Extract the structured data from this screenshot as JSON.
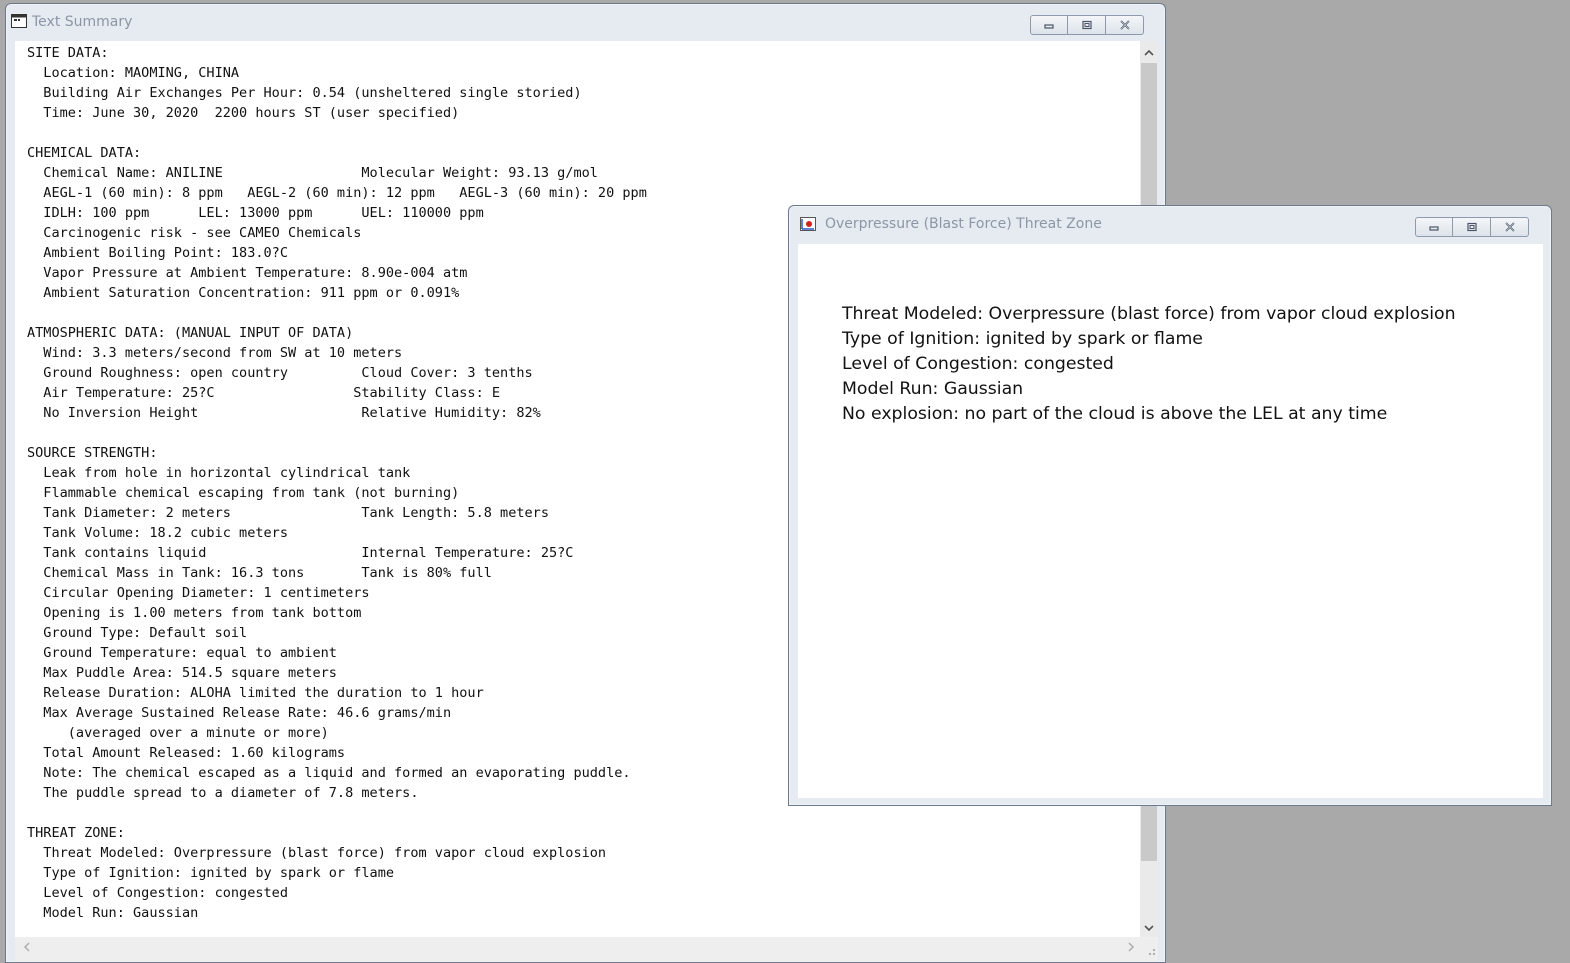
{
  "text_summary_window": {
    "title": "Text Summary",
    "lines": [
      "SITE DATA:",
      "  Location: MAOMING, CHINA",
      "  Building Air Exchanges Per Hour: 0.54 (unsheltered single storied)",
      "  Time: June 30, 2020  2200 hours ST (user specified)",
      "",
      "CHEMICAL DATA:",
      "  Chemical Name: ANILINE                 Molecular Weight: 93.13 g/mol",
      "  AEGL-1 (60 min): 8 ppm   AEGL-2 (60 min): 12 ppm   AEGL-3 (60 min): 20 ppm",
      "  IDLH: 100 ppm      LEL: 13000 ppm      UEL: 110000 ppm",
      "  Carcinogenic risk - see CAMEO Chemicals",
      "  Ambient Boiling Point: 183.0?C",
      "  Vapor Pressure at Ambient Temperature: 8.90e-004 atm",
      "  Ambient Saturation Concentration: 911 ppm or 0.091%",
      "",
      "ATMOSPHERIC DATA: (MANUAL INPUT OF DATA)",
      "  Wind: 3.3 meters/second from SW at 10 meters",
      "  Ground Roughness: open country         Cloud Cover: 3 tenths",
      "  Air Temperature: 25?C                 Stability Class: E",
      "  No Inversion Height                    Relative Humidity: 82%",
      "",
      "SOURCE STRENGTH:",
      "  Leak from hole in horizontal cylindrical tank",
      "  Flammable chemical escaping from tank (not burning)",
      "  Tank Diameter: 2 meters                Tank Length: 5.8 meters",
      "  Tank Volume: 18.2 cubic meters",
      "  Tank contains liquid                   Internal Temperature: 25?C",
      "  Chemical Mass in Tank: 16.3 tons       Tank is 80% full",
      "  Circular Opening Diameter: 1 centimeters",
      "  Opening is 1.00 meters from tank bottom",
      "  Ground Type: Default soil",
      "  Ground Temperature: equal to ambient",
      "  Max Puddle Area: 514.5 square meters",
      "  Release Duration: ALOHA limited the duration to 1 hour",
      "  Max Average Sustained Release Rate: 46.6 grams/min",
      "     (averaged over a minute or more)",
      "  Total Amount Released: 1.60 kilograms",
      "  Note: The chemical escaped as a liquid and formed an evaporating puddle.",
      "  The puddle spread to a diameter of 7.8 meters.",
      "",
      "THREAT ZONE:",
      "  Threat Modeled: Overpressure (blast force) from vapor cloud explosion",
      "  Type of Ignition: ignited by spark or flame",
      "  Level of Congestion: congested",
      "  Model Run: Gaussian"
    ]
  },
  "overpressure_window": {
    "title": "Overpressure (Blast Force) Threat Zone",
    "lines": [
      "Threat Modeled: Overpressure (blast force) from vapor cloud explosion",
      "Type of Ignition: ignited by spark or flame",
      "Level of Congestion: congested",
      "Model Run: Gaussian",
      "No explosion: no part of the cloud is above the LEL at any time"
    ]
  },
  "icons": {
    "minimize": "minimize-icon",
    "maximize": "maximize-icon",
    "close": "close-icon",
    "scroll_up": "chevron-up-icon",
    "scroll_down": "chevron-down-icon",
    "scroll_left": "chevron-left-icon",
    "scroll_right": "chevron-right-icon"
  },
  "colors": {
    "desktop": "#a9a9a9",
    "window_frame": "#e6ebf2",
    "title_text": "#8c96a4",
    "icon_red": "#d81e1e"
  }
}
